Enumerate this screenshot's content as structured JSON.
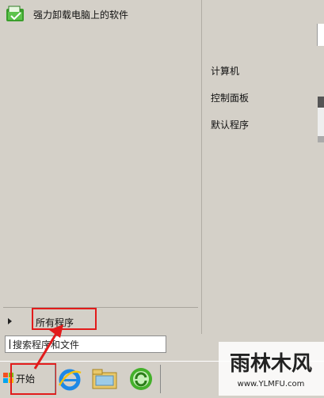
{
  "start_menu": {
    "pinned_program": "强力卸载电脑上的软件",
    "all_programs": "所有程序",
    "search_placeholder": "搜索程序和文件"
  },
  "right_pane": {
    "items": [
      "计算机",
      "控制面板",
      "默认程序"
    ]
  },
  "taskbar": {
    "start_label": "开始",
    "apps": [
      "internet-explorer-icon",
      "file-explorer-icon",
      "refresh-green-icon"
    ]
  },
  "watermark": {
    "line1": "雨林木风",
    "line2": "www.YLMFU.com"
  },
  "colors": {
    "highlight": "#e21b1b",
    "menu_bg": "#d4d0c8"
  }
}
